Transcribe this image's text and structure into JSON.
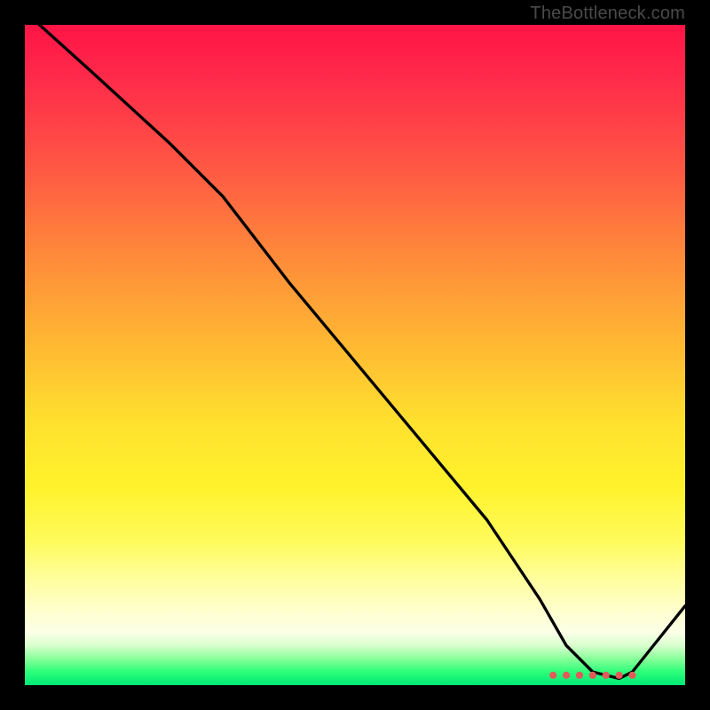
{
  "watermark": {
    "text": "TheBottleneck.com"
  },
  "chart_data": {
    "type": "line",
    "title": "",
    "xlabel": "",
    "ylabel": "",
    "xlim": [
      0,
      100
    ],
    "ylim": [
      0,
      100
    ],
    "background": "heatmap-gradient-red-yellow-green-vertical",
    "series": [
      {
        "name": "bottleneck-curve",
        "x": [
          0,
          10,
          22,
          30,
          40,
          50,
          60,
          70,
          78,
          82,
          86,
          90,
          92,
          100
        ],
        "y": [
          102,
          93,
          82,
          74,
          61,
          49,
          37,
          25,
          13,
          6,
          2,
          1,
          2,
          12
        ]
      }
    ],
    "markers": {
      "name": "optimal-range",
      "color": "#e25a5a",
      "points_x": [
        80,
        82,
        84,
        86,
        88,
        90,
        92
      ],
      "y": 1.5
    }
  }
}
